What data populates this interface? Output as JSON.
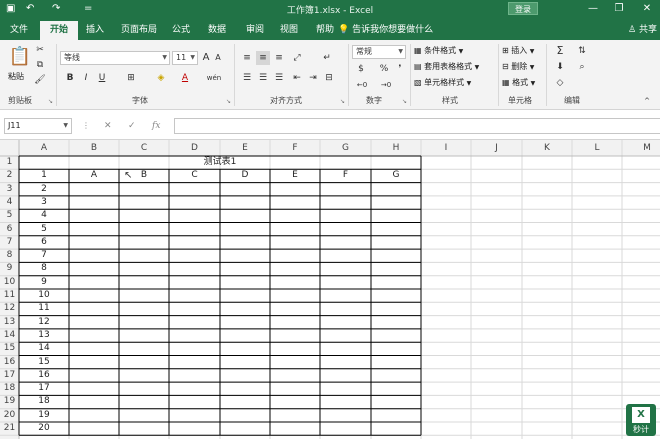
{
  "window": {
    "title": "工作簿1.xlsx  -  Excel",
    "login_label": "登录",
    "controls": [
      "—",
      "❐",
      "✕"
    ]
  },
  "quick_access": [
    "▣",
    "↶",
    "↷",
    "="
  ],
  "tabs": [
    {
      "label": "文件",
      "active": false
    },
    {
      "label": "开始",
      "active": true
    },
    {
      "label": "插入",
      "active": false
    },
    {
      "label": "页面布局",
      "active": false
    },
    {
      "label": "公式",
      "active": false
    },
    {
      "label": "数据",
      "active": false
    },
    {
      "label": "审阅",
      "active": false
    },
    {
      "label": "视图",
      "active": false
    },
    {
      "label": "帮助",
      "active": false
    }
  ],
  "tell_me": "告诉我你想要做什么",
  "share": "共享",
  "ribbon": {
    "clipboard": {
      "paste": "粘贴",
      "label": "剪贴板"
    },
    "font": {
      "name": "等线",
      "size": "11",
      "label": "字体",
      "bold": "B",
      "italic": "I",
      "underline": "U"
    },
    "alignment": {
      "label": "对齐方式"
    },
    "number": {
      "format": "常规",
      "label": "数字",
      "percent": "%"
    },
    "styles": {
      "conditional": "条件格式",
      "table": "套用表格格式",
      "cell": "单元格样式",
      "label": "样式"
    },
    "cells": {
      "insert": "插入",
      "delete": "删除",
      "format": "格式",
      "label": "单元格"
    },
    "editing": {
      "label": "编辑"
    }
  },
  "name_box": "J11",
  "fx_label": "fx",
  "sheet": {
    "columns": [
      "A",
      "B",
      "C",
      "D",
      "E",
      "F",
      "G",
      "H",
      "I",
      "J",
      "K",
      "L",
      "M"
    ],
    "rows": [
      "1",
      "2",
      "3",
      "4",
      "5",
      "6",
      "7",
      "8",
      "9",
      "10",
      "11",
      "12",
      "13",
      "14",
      "15",
      "16",
      "17",
      "18",
      "19",
      "20",
      "21"
    ],
    "title_cell": "测试表1",
    "row2_headers": [
      "1",
      "A",
      "B",
      "C",
      "D",
      "E",
      "F",
      "G"
    ],
    "col_a_values": [
      "2",
      "3",
      "4",
      "5",
      "6",
      "7",
      "8",
      "9",
      "10",
      "11",
      "12",
      "13",
      "14",
      "15",
      "16",
      "17",
      "18",
      "19",
      "20"
    ]
  },
  "logo_label": "秒计",
  "colors": {
    "brand": "#217346",
    "ribbon_bg": "#f3f3f3",
    "header_bg": "#f2f2f2"
  }
}
